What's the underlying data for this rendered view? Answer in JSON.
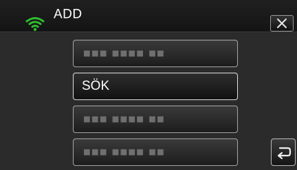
{
  "header": {
    "title": "ADD",
    "wifi_icon": "wifi-icon",
    "wifi_color": "#2fbf2f",
    "close_icon": "close-icon"
  },
  "list": {
    "items": [
      {
        "kind": "masked",
        "label": "■■■ ■■■■ ■■"
      },
      {
        "kind": "text",
        "label": "SÖK"
      },
      {
        "kind": "masked",
        "label": "■■■ ■■■■ ■■"
      },
      {
        "kind": "masked",
        "label": "■■■ ■■■■ ■■"
      }
    ],
    "selected_index": 1
  },
  "footer": {
    "back_icon": "back-icon"
  }
}
